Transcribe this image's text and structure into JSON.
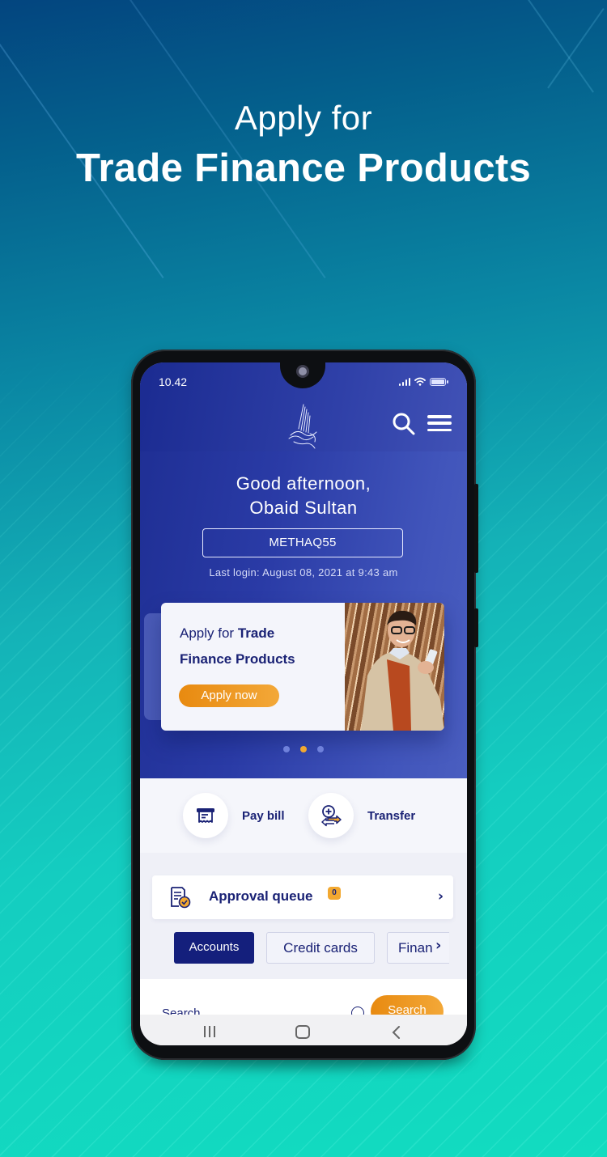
{
  "headline": {
    "line1": "Apply for",
    "line2": "Trade Finance Products"
  },
  "status_bar": {
    "time": "10.42",
    "icons": [
      "signal-icon",
      "wifi-icon",
      "battery-icon"
    ]
  },
  "app_header": {
    "logo": "calligraphy-logo",
    "search_icon": "search-icon",
    "menu_icon": "hamburger-menu-icon"
  },
  "greeting": {
    "line1": "Good afternoon,",
    "line2": "Obaid Sultan",
    "user_id": "METHAQ55",
    "last_login": "Last login: August 08, 2021 at 9:43 am"
  },
  "promo": {
    "text_regular": "Apply for ",
    "text_bold_1": "Trade",
    "text_bold_2": "Finance Products",
    "cta": "Apply now",
    "carousel": {
      "total": 3,
      "active_index": 1
    }
  },
  "quick_actions": [
    {
      "label": "Pay bill",
      "icon": "bill-icon"
    },
    {
      "label": "Transfer",
      "icon": "transfer-icon"
    }
  ],
  "approval_queue": {
    "label": "Approval queue",
    "count": "0"
  },
  "tabs": [
    {
      "label": "Accounts",
      "active": true
    },
    {
      "label": "Credit cards",
      "active": false
    },
    {
      "label": "Finan",
      "active": false
    }
  ],
  "search": {
    "placeholder": "Search",
    "button": "Search"
  },
  "colors": {
    "primary": "#1a2275",
    "hero_blue": "#2a3ba6",
    "accent_orange": "#f2a830",
    "bg_teal": "#14cdc0"
  }
}
